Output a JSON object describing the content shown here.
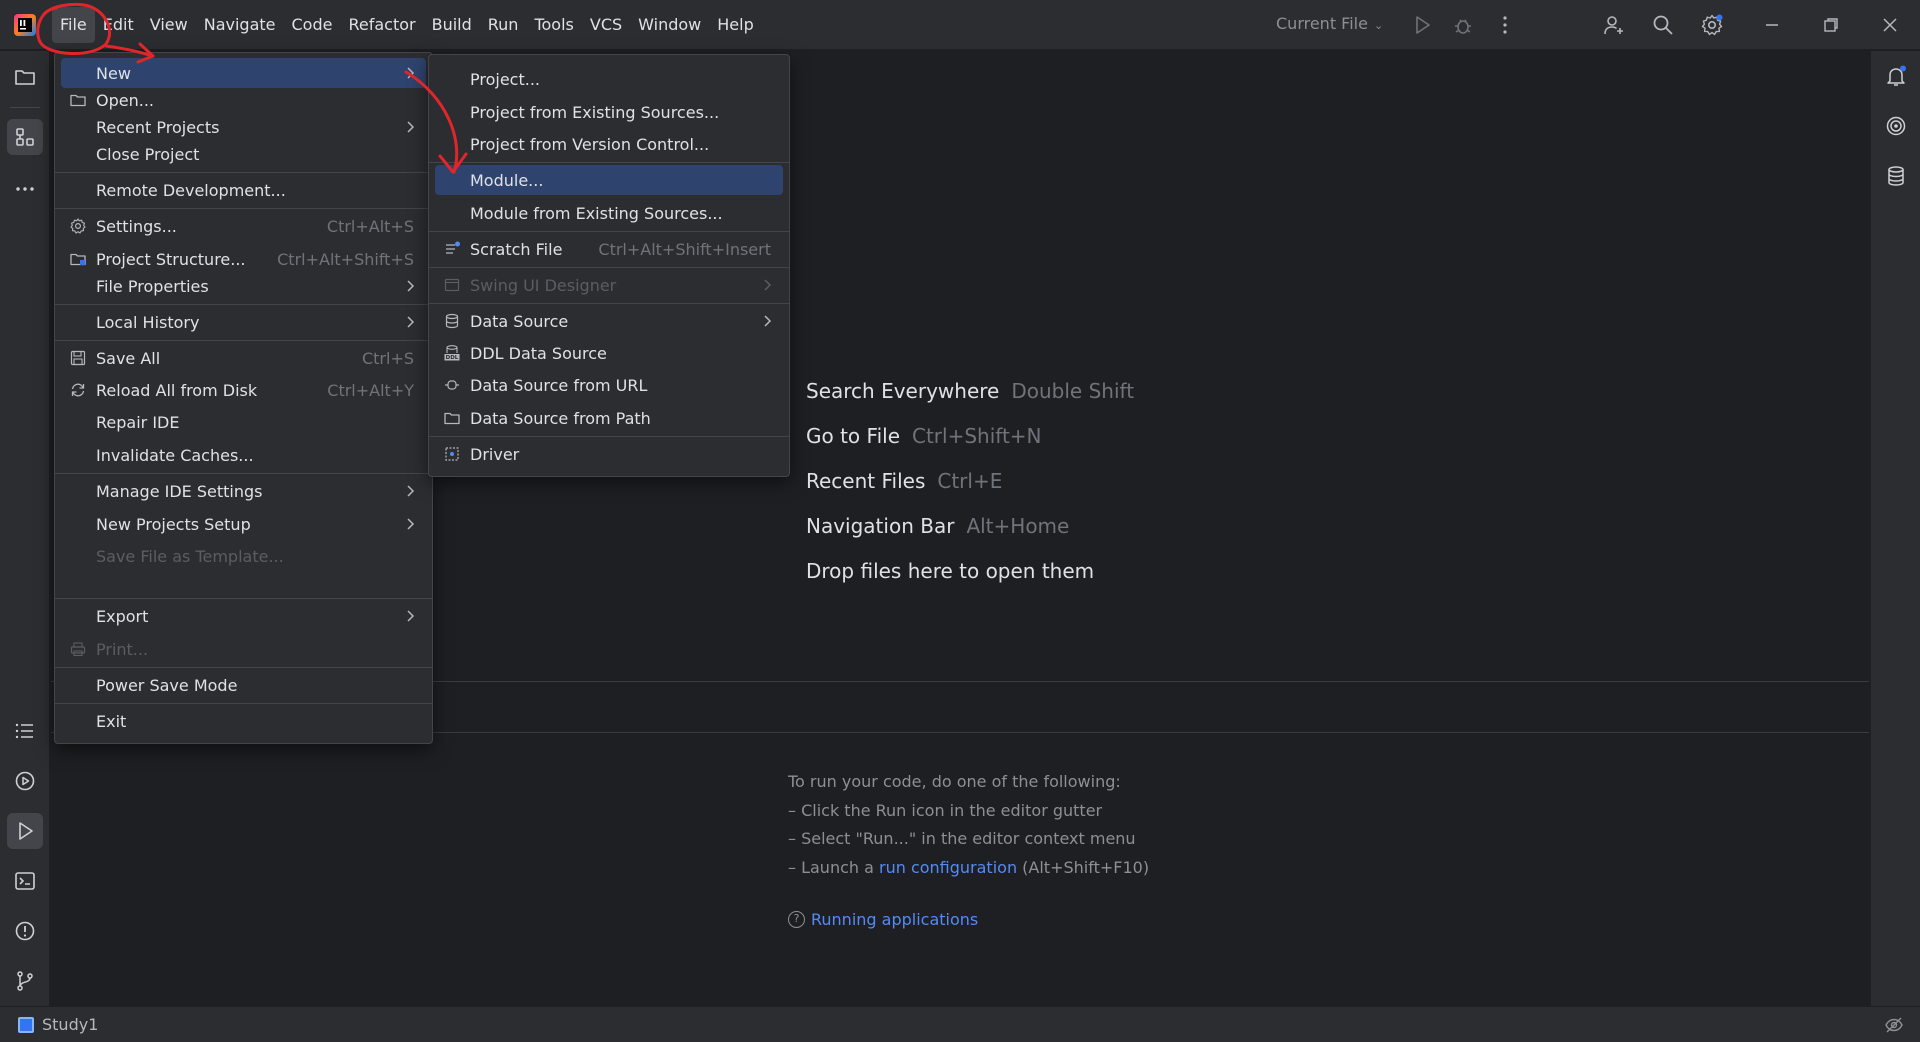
{
  "menubar": {
    "items": [
      "File",
      "Edit",
      "View",
      "Navigate",
      "Code",
      "Refactor",
      "Build",
      "Run",
      "Tools",
      "VCS",
      "Window",
      "Help"
    ]
  },
  "toolbar": {
    "run_config": "Current File"
  },
  "file_menu": {
    "items": [
      {
        "label": "New",
        "shortcut": ""
      },
      {
        "label": "Open...",
        "shortcut": ""
      },
      {
        "label": "Recent Projects",
        "shortcut": ""
      },
      {
        "label": "Close Project",
        "shortcut": ""
      },
      {
        "label": "Remote Development...",
        "shortcut": ""
      },
      {
        "label": "Settings...",
        "shortcut": "Ctrl+Alt+S"
      },
      {
        "label": "Project Structure...",
        "shortcut": "Ctrl+Alt+Shift+S"
      },
      {
        "label": "File Properties",
        "shortcut": ""
      },
      {
        "label": "Local History",
        "shortcut": ""
      },
      {
        "label": "Save All",
        "shortcut": "Ctrl+S"
      },
      {
        "label": "Reload All from Disk",
        "shortcut": "Ctrl+Alt+Y"
      },
      {
        "label": "Repair IDE",
        "shortcut": ""
      },
      {
        "label": "Invalidate Caches...",
        "shortcut": ""
      },
      {
        "label": "Manage IDE Settings",
        "shortcut": ""
      },
      {
        "label": "New Projects Setup",
        "shortcut": ""
      },
      {
        "label": "Save File as Template...",
        "shortcut": ""
      },
      {
        "label": "Export",
        "shortcut": ""
      },
      {
        "label": "Print...",
        "shortcut": ""
      },
      {
        "label": "Power Save Mode",
        "shortcut": ""
      },
      {
        "label": "Exit",
        "shortcut": ""
      }
    ]
  },
  "new_menu": {
    "items": [
      {
        "label": "Project...",
        "shortcut": ""
      },
      {
        "label": "Project from Existing Sources...",
        "shortcut": ""
      },
      {
        "label": "Project from Version Control...",
        "shortcut": ""
      },
      {
        "label": "Module...",
        "shortcut": ""
      },
      {
        "label": "Module from Existing Sources...",
        "shortcut": ""
      },
      {
        "label": "Scratch File",
        "shortcut": "Ctrl+Alt+Shift+Insert"
      },
      {
        "label": "Swing UI Designer",
        "shortcut": ""
      },
      {
        "label": "Data Source",
        "shortcut": ""
      },
      {
        "label": "DDL Data Source",
        "shortcut": ""
      },
      {
        "label": "Data Source from URL",
        "shortcut": ""
      },
      {
        "label": "Data Source from Path",
        "shortcut": ""
      },
      {
        "label": "Driver",
        "shortcut": ""
      }
    ]
  },
  "editor_hints": [
    {
      "label": "Search Everywhere",
      "shortcut": "Double Shift"
    },
    {
      "label": "Go to File",
      "shortcut": "Ctrl+Shift+N"
    },
    {
      "label": "Recent Files",
      "shortcut": "Ctrl+E"
    },
    {
      "label": "Navigation Bar",
      "shortcut": "Alt+Home"
    },
    {
      "label": "Drop files here to open them",
      "shortcut": ""
    }
  ],
  "run_panel": {
    "line1": "To run your code, do one of the following:",
    "line2": "– Click the Run icon in the editor gutter",
    "line3": "– Select \"Run...\" in the editor context menu",
    "line4_prefix": "– Launch a ",
    "line4_link": "run configuration",
    "line4_suffix": " (Alt+Shift+F10)",
    "help_link": "Running applications"
  },
  "statusbar": {
    "project": "Study1"
  },
  "colors": {
    "highlight": "#2e436e",
    "link": "#548af7",
    "annotation": "#e0262b"
  }
}
